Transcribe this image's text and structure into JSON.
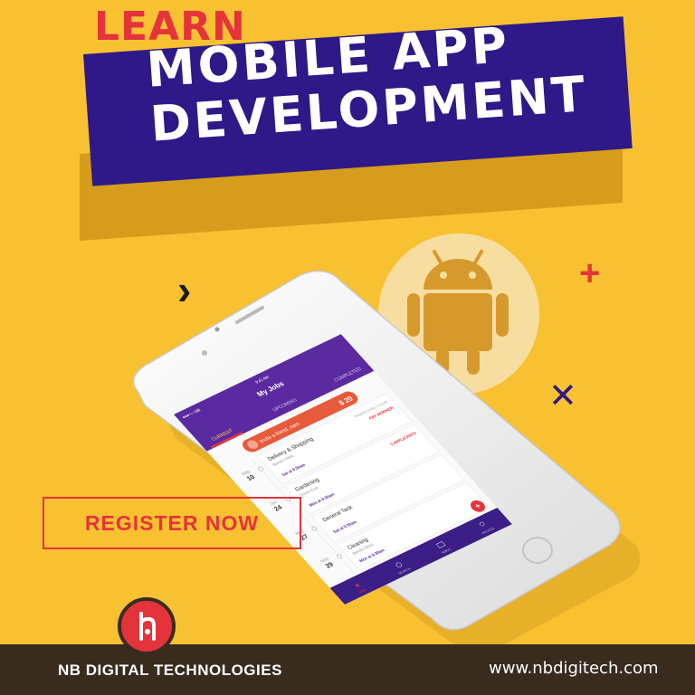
{
  "heading": {
    "kicker": "LEARN",
    "line1": "MOBILE APP",
    "line2": "DEVELOPMENT"
  },
  "cta": {
    "label": "REGISTER NOW"
  },
  "footer": {
    "brand": "NB DIGITAL TECHNOLOGIES",
    "url": "www.nbdigitech.com"
  },
  "colors": {
    "background": "#f8c131",
    "banner": "#2f1888",
    "accent_red": "#e5333b",
    "footer": "#3a2b1f",
    "android": "#d69a2c"
  },
  "icons": [
    "chevron-right-icon",
    "plus-icon",
    "cross-icon",
    "android-icon",
    "nb-logo-icon"
  ],
  "phone": {
    "status": {
      "carrier": "●●●○○ UIB",
      "time": "9:41 AM"
    },
    "title": "My Jobs",
    "tabs": [
      "CURRENT",
      "UPCOMING",
      "COMPLETED"
    ],
    "invite": {
      "text": "Invite a friend, earn",
      "amount": "$ 20"
    },
    "jobs": [
      {
        "month": "May",
        "day": "10",
        "title": "Delivery & Shopping",
        "sub": "Bandra West",
        "meta": "Reqests today 2 weeks",
        "tag": "PAY WORKER",
        "time": "Sat at 9:30am"
      },
      {
        "month": "Jun",
        "day": "24",
        "title": "Gardening",
        "sub": "Dadar East",
        "meta": "",
        "tag": "3 APPLICANTS",
        "time": "Mon at 9:30am"
      },
      {
        "month": "May",
        "day": "27",
        "title": "General Task",
        "sub": "",
        "meta": "",
        "tag": "",
        "time": "Sat at 9:30am"
      },
      {
        "month": "Mon",
        "day": "29",
        "title": "Cleaning",
        "sub": "Bandra West",
        "meta": "",
        "tag": "",
        "time": "Mon at 9:30am"
      }
    ],
    "nav": [
      "JOBS",
      "SEARCH",
      "INBOX",
      "PROFILE"
    ]
  }
}
